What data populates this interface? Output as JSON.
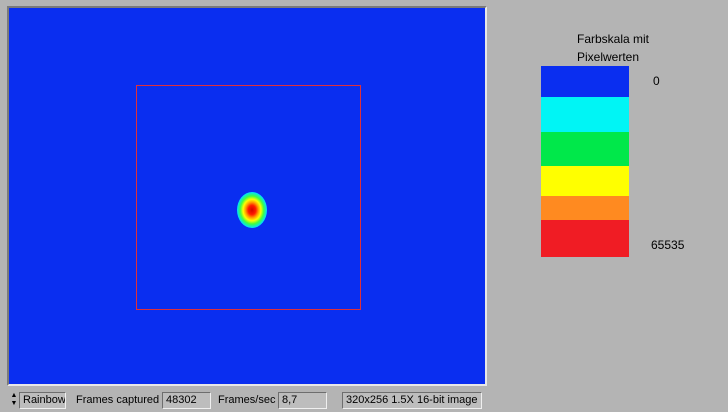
{
  "viewer": {
    "background": "#0a2ef0",
    "roi_color": "#e0303a"
  },
  "statusbar": {
    "palette_value": "Rainbow",
    "frames_captured_label": "Frames captured",
    "frames_captured_value": "48302",
    "fps_label": "Frames/sec",
    "fps_value": "8,7",
    "image_info": "320x256 1.5X 16-bit image"
  },
  "legend": {
    "title_line1": "Farbskala mit",
    "title_line2": "Pixelwerten",
    "min_label": "0",
    "max_label": "65535",
    "colors": [
      "#0a2ef0",
      "#00f5f5",
      "#00e84a",
      "#ffff00",
      "#ff8a20",
      "#f01c24"
    ]
  }
}
